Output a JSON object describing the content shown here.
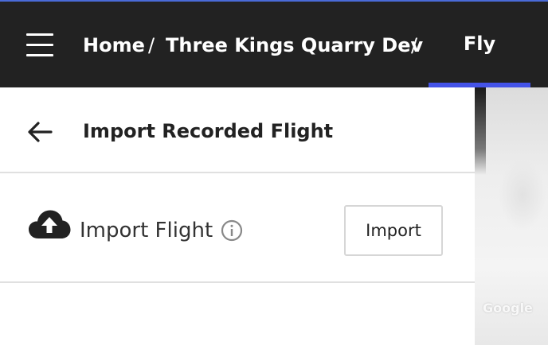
{
  "header": {
    "breadcrumbs": [
      "Home",
      "Three Kings Quarry Dev"
    ],
    "separator": "/",
    "active_tab": "Fly",
    "accent_color": "#4453e8",
    "background_color": "#222222"
  },
  "panel": {
    "title": "Import Recorded Flight",
    "back_icon": "arrow-left-icon",
    "row": {
      "icon": "cloud-upload-icon",
      "label": "Import Flight",
      "info_icon": "info-icon",
      "button_label": "Import"
    }
  },
  "map": {
    "watermark": "Google"
  }
}
